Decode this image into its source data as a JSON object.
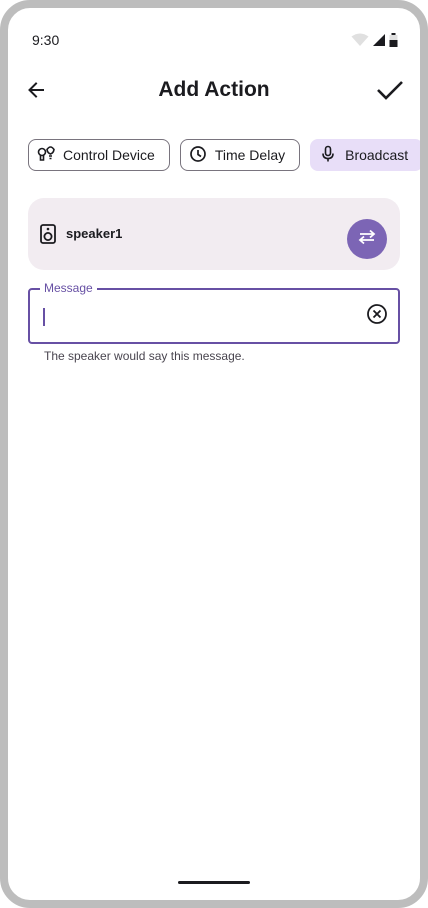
{
  "status_bar": {
    "time": "9:30",
    "icons": [
      "wifi-icon",
      "cellular-signal-icon",
      "battery-icon"
    ]
  },
  "app_bar": {
    "title": "Add Action",
    "back_icon": "arrow-back-icon",
    "confirm_icon": "check-icon"
  },
  "chips": [
    {
      "label": "Control Device",
      "icon": "control-device-icon",
      "selected": false
    },
    {
      "label": "Time Delay",
      "icon": "clock-icon",
      "selected": false
    },
    {
      "label": "Broadcast",
      "icon": "mic-icon",
      "selected": true
    }
  ],
  "device_card": {
    "icon": "speaker-icon",
    "name": "speaker1",
    "action_icon": "swap-icon"
  },
  "message_field": {
    "label": "Message",
    "value": "",
    "helper": "The speaker would say this message.",
    "clear_icon": "clear-circle-icon"
  },
  "colors": {
    "accent": "#6750a4",
    "swap_button": "#7c65b5",
    "selected_chip": "#e8def8",
    "card_background": "#f2ecf1"
  }
}
